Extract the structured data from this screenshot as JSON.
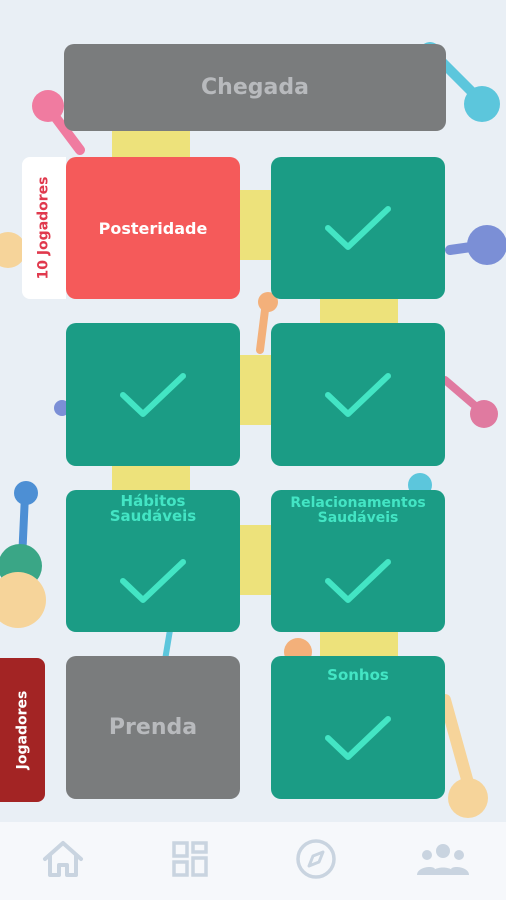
{
  "board": {
    "finish_label": "Chegada",
    "tiles": [
      {
        "id": "posteridade",
        "label": "Posteridade",
        "state": "active"
      },
      {
        "id": "row1-right",
        "label": "",
        "state": "done"
      },
      {
        "id": "row2-left",
        "label": "",
        "state": "done"
      },
      {
        "id": "row2-right",
        "label": "",
        "state": "done"
      },
      {
        "id": "habitos",
        "label": "Hábitos Saudáveis",
        "state": "done"
      },
      {
        "id": "relacionamentos",
        "label": "Relacionamentos Saudáveis",
        "state": "done"
      },
      {
        "id": "prenda",
        "label": "Prenda",
        "state": "locked"
      },
      {
        "id": "sonhos",
        "label": "Sonhos",
        "state": "done"
      }
    ]
  },
  "side_tabs": {
    "players_count": "10 Jogadores",
    "players": "Jogadores"
  },
  "nav": [
    {
      "icon": "home-icon"
    },
    {
      "icon": "grid-icon"
    },
    {
      "icon": "compass-icon"
    },
    {
      "icon": "people-icon"
    }
  ],
  "colors": {
    "tile_done": "#1b9c85",
    "tile_active": "#f55a5a",
    "tile_locked": "#7a7c7d",
    "check": "#43e5c4",
    "players_tab": "#a32424",
    "background": "#e9eff5"
  }
}
